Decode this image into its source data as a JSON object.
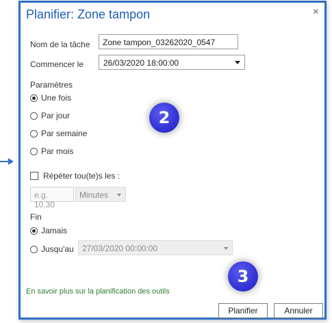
{
  "dialog": {
    "title": "Planifier: Zone tampon",
    "close_glyph": "×"
  },
  "form": {
    "task_name_label": "Nom de la tâche",
    "task_name_value": "Zone tampon_03262020_0547",
    "start_label": "Commencer le",
    "start_value": "26/03/2020 18:00:00"
  },
  "parameters": {
    "heading": "Paramètres",
    "options": [
      {
        "label": "Une fois",
        "selected": true
      },
      {
        "label": "Par jour",
        "selected": false
      },
      {
        "label": "Par semaine",
        "selected": false
      },
      {
        "label": "Par mois",
        "selected": false
      }
    ]
  },
  "repeat": {
    "label": "Répéter tou(te)s les :",
    "checked": false,
    "interval_placeholder": "e.g. 10,30",
    "unit_value": "Minutes"
  },
  "end": {
    "heading": "Fin",
    "never_label": "Jamais",
    "never_selected": true,
    "until_label": "Jusqu'au",
    "until_selected": false,
    "until_value": "27/03/2020 00:00:00"
  },
  "badges": {
    "step_two": "2",
    "step_three": "3"
  },
  "footer": {
    "learn_more": "En savoir plus sur la planification des outils",
    "schedule_button": "Planifier",
    "cancel_button": "Annuler"
  },
  "colors": {
    "accent": "#2e6fc6",
    "title_color": "#1e5fb3",
    "link_color": "#2e7d32",
    "badge_color": "#3333d6"
  }
}
